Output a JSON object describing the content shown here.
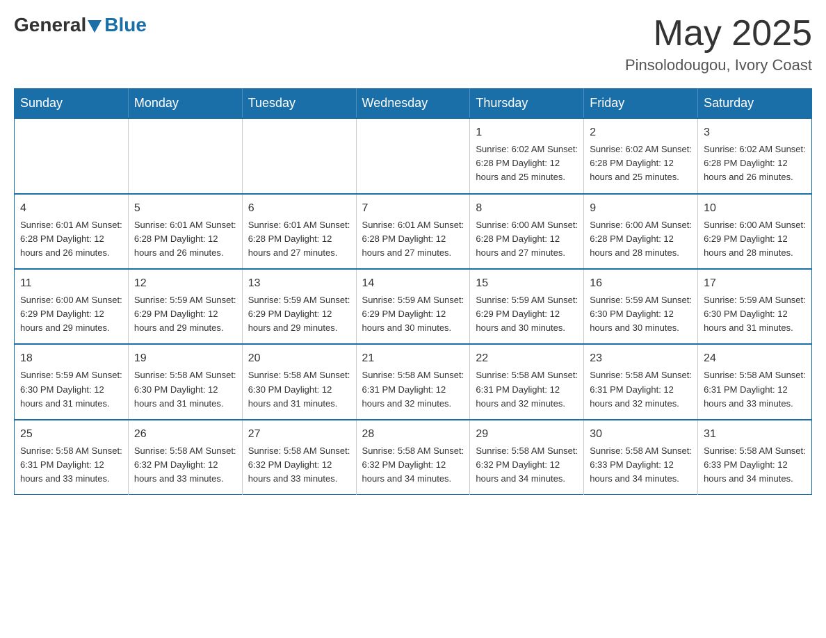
{
  "logo": {
    "general": "General",
    "blue": "Blue"
  },
  "title": "May 2025",
  "location": "Pinsolodougou, Ivory Coast",
  "days_of_week": [
    "Sunday",
    "Monday",
    "Tuesday",
    "Wednesday",
    "Thursday",
    "Friday",
    "Saturday"
  ],
  "weeks": [
    {
      "days": [
        {
          "number": "",
          "info": ""
        },
        {
          "number": "",
          "info": ""
        },
        {
          "number": "",
          "info": ""
        },
        {
          "number": "",
          "info": ""
        },
        {
          "number": "1",
          "info": "Sunrise: 6:02 AM\nSunset: 6:28 PM\nDaylight: 12 hours\nand 25 minutes."
        },
        {
          "number": "2",
          "info": "Sunrise: 6:02 AM\nSunset: 6:28 PM\nDaylight: 12 hours\nand 25 minutes."
        },
        {
          "number": "3",
          "info": "Sunrise: 6:02 AM\nSunset: 6:28 PM\nDaylight: 12 hours\nand 26 minutes."
        }
      ]
    },
    {
      "days": [
        {
          "number": "4",
          "info": "Sunrise: 6:01 AM\nSunset: 6:28 PM\nDaylight: 12 hours\nand 26 minutes."
        },
        {
          "number": "5",
          "info": "Sunrise: 6:01 AM\nSunset: 6:28 PM\nDaylight: 12 hours\nand 26 minutes."
        },
        {
          "number": "6",
          "info": "Sunrise: 6:01 AM\nSunset: 6:28 PM\nDaylight: 12 hours\nand 27 minutes."
        },
        {
          "number": "7",
          "info": "Sunrise: 6:01 AM\nSunset: 6:28 PM\nDaylight: 12 hours\nand 27 minutes."
        },
        {
          "number": "8",
          "info": "Sunrise: 6:00 AM\nSunset: 6:28 PM\nDaylight: 12 hours\nand 27 minutes."
        },
        {
          "number": "9",
          "info": "Sunrise: 6:00 AM\nSunset: 6:28 PM\nDaylight: 12 hours\nand 28 minutes."
        },
        {
          "number": "10",
          "info": "Sunrise: 6:00 AM\nSunset: 6:29 PM\nDaylight: 12 hours\nand 28 minutes."
        }
      ]
    },
    {
      "days": [
        {
          "number": "11",
          "info": "Sunrise: 6:00 AM\nSunset: 6:29 PM\nDaylight: 12 hours\nand 29 minutes."
        },
        {
          "number": "12",
          "info": "Sunrise: 5:59 AM\nSunset: 6:29 PM\nDaylight: 12 hours\nand 29 minutes."
        },
        {
          "number": "13",
          "info": "Sunrise: 5:59 AM\nSunset: 6:29 PM\nDaylight: 12 hours\nand 29 minutes."
        },
        {
          "number": "14",
          "info": "Sunrise: 5:59 AM\nSunset: 6:29 PM\nDaylight: 12 hours\nand 30 minutes."
        },
        {
          "number": "15",
          "info": "Sunrise: 5:59 AM\nSunset: 6:29 PM\nDaylight: 12 hours\nand 30 minutes."
        },
        {
          "number": "16",
          "info": "Sunrise: 5:59 AM\nSunset: 6:30 PM\nDaylight: 12 hours\nand 30 minutes."
        },
        {
          "number": "17",
          "info": "Sunrise: 5:59 AM\nSunset: 6:30 PM\nDaylight: 12 hours\nand 31 minutes."
        }
      ]
    },
    {
      "days": [
        {
          "number": "18",
          "info": "Sunrise: 5:59 AM\nSunset: 6:30 PM\nDaylight: 12 hours\nand 31 minutes."
        },
        {
          "number": "19",
          "info": "Sunrise: 5:58 AM\nSunset: 6:30 PM\nDaylight: 12 hours\nand 31 minutes."
        },
        {
          "number": "20",
          "info": "Sunrise: 5:58 AM\nSunset: 6:30 PM\nDaylight: 12 hours\nand 31 minutes."
        },
        {
          "number": "21",
          "info": "Sunrise: 5:58 AM\nSunset: 6:31 PM\nDaylight: 12 hours\nand 32 minutes."
        },
        {
          "number": "22",
          "info": "Sunrise: 5:58 AM\nSunset: 6:31 PM\nDaylight: 12 hours\nand 32 minutes."
        },
        {
          "number": "23",
          "info": "Sunrise: 5:58 AM\nSunset: 6:31 PM\nDaylight: 12 hours\nand 32 minutes."
        },
        {
          "number": "24",
          "info": "Sunrise: 5:58 AM\nSunset: 6:31 PM\nDaylight: 12 hours\nand 33 minutes."
        }
      ]
    },
    {
      "days": [
        {
          "number": "25",
          "info": "Sunrise: 5:58 AM\nSunset: 6:31 PM\nDaylight: 12 hours\nand 33 minutes."
        },
        {
          "number": "26",
          "info": "Sunrise: 5:58 AM\nSunset: 6:32 PM\nDaylight: 12 hours\nand 33 minutes."
        },
        {
          "number": "27",
          "info": "Sunrise: 5:58 AM\nSunset: 6:32 PM\nDaylight: 12 hours\nand 33 minutes."
        },
        {
          "number": "28",
          "info": "Sunrise: 5:58 AM\nSunset: 6:32 PM\nDaylight: 12 hours\nand 34 minutes."
        },
        {
          "number": "29",
          "info": "Sunrise: 5:58 AM\nSunset: 6:32 PM\nDaylight: 12 hours\nand 34 minutes."
        },
        {
          "number": "30",
          "info": "Sunrise: 5:58 AM\nSunset: 6:33 PM\nDaylight: 12 hours\nand 34 minutes."
        },
        {
          "number": "31",
          "info": "Sunrise: 5:58 AM\nSunset: 6:33 PM\nDaylight: 12 hours\nand 34 minutes."
        }
      ]
    }
  ]
}
